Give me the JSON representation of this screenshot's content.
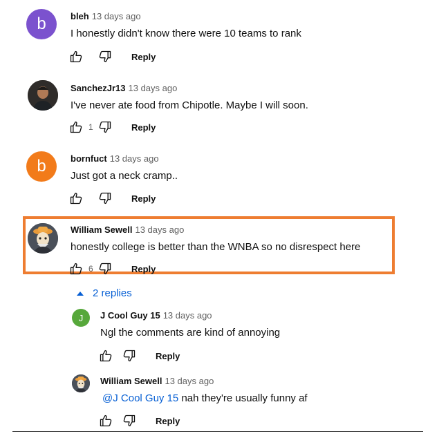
{
  "comments": [
    {
      "avatar_letter": "b",
      "avatar_color": "#7b52ce",
      "author": "bleh",
      "time": "13 days ago",
      "text": "I honestly didn't know there were 10 teams to rank",
      "likes": "",
      "reply_label": "Reply"
    },
    {
      "avatar_letter": "",
      "avatar_color": "#3e3a36",
      "author": "SanchezJr13",
      "time": "13 days ago",
      "text": "I've never ate food from Chipotle. Maybe I will soon.",
      "likes": "1",
      "reply_label": "Reply"
    },
    {
      "avatar_letter": "b",
      "avatar_color": "#f27b1a",
      "author": "bornfuct",
      "time": "13 days ago",
      "text": "Just got a neck cramp..",
      "likes": "",
      "reply_label": "Reply"
    },
    {
      "avatar_letter": "",
      "avatar_color": "#3a3f4a",
      "author": "William Sewell",
      "time": "13 days ago",
      "text": "honestly college is better than the WNBA so no disrespect here",
      "likes": "6",
      "reply_label": "Reply"
    }
  ],
  "replies_toggle": {
    "label": "2 replies",
    "expanded": true,
    "color": "#065fd4"
  },
  "replies": [
    {
      "avatar_letter": "J",
      "avatar_color": "#57a83b",
      "author": "J Cool Guy 15",
      "time": "13 days ago",
      "mention": "",
      "text": "Ngl the comments are kind of annoying",
      "reply_label": "Reply"
    },
    {
      "avatar_letter": "",
      "avatar_color": "#3a3f4a",
      "author": "William Sewell",
      "time": "13 days ago",
      "mention": "@J Cool Guy 15",
      "text": "nah they're usually funny af",
      "reply_label": "Reply"
    }
  ],
  "icons": {
    "like": "thumbs-up-icon",
    "dislike": "thumbs-down-icon",
    "toggle": "caret-up-icon"
  },
  "highlight_color": "#ee7d31"
}
